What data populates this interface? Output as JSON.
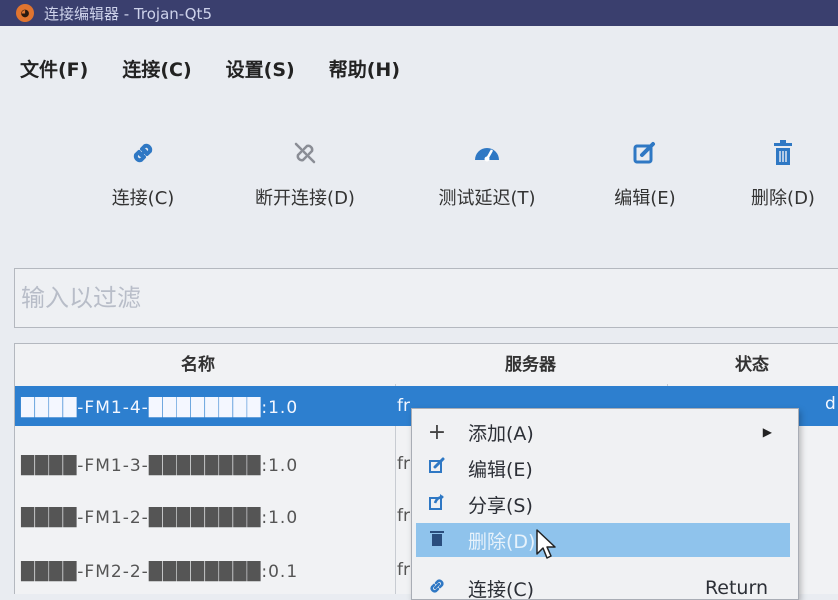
{
  "window": {
    "title": "连接编辑器 - Trojan-Qt5"
  },
  "menu": [
    "文件(F)",
    "连接(C)",
    "设置(S)",
    "帮助(H)"
  ],
  "toolbar": {
    "connect": "连接(C)",
    "disconnect": "断开连接(D)",
    "latency": "测试延迟(T)",
    "edit": "编辑(E)",
    "delete": "删除(D)"
  },
  "filter": {
    "placeholder": "输入以过滤"
  },
  "table": {
    "headers": [
      "名称",
      "服务器",
      "状态"
    ],
    "rows": [
      {
        "name": "████-FM1-4-████████:1.0",
        "server": "fr",
        "status": ""
      },
      {
        "name": "████-FM1-3-████████:1.0",
        "server": "fr",
        "status": ""
      },
      {
        "name": "████-FM1-2-████████:1.0",
        "server": "fr",
        "status": ""
      },
      {
        "name": "████-FM2-2-████████:0.1",
        "server": "fr",
        "status": ""
      }
    ],
    "selected_status_fragment": "d"
  },
  "context_menu": {
    "items": [
      {
        "label": "添加(A)",
        "icon": "plus-icon",
        "submenu": true
      },
      {
        "label": "编辑(E)",
        "icon": "edit-icon"
      },
      {
        "label": "分享(S)",
        "icon": "share-icon"
      },
      {
        "label": "删除(D)",
        "icon": "trash-icon",
        "highlighted": true
      },
      {
        "label": "连接(C)",
        "icon": "link-icon",
        "shortcut": "Return"
      }
    ]
  },
  "colors": {
    "accent": "#2f78c4",
    "selection": "#2d7fcf",
    "menu_highlight": "#8fc3ec",
    "titlebar": "#3a3f6e"
  }
}
